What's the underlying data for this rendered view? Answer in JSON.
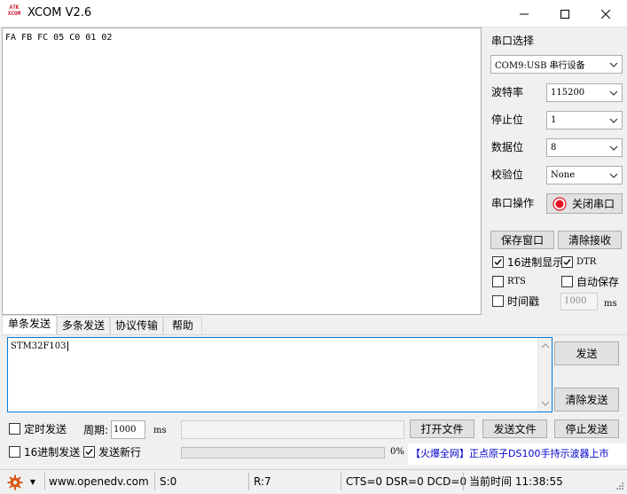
{
  "window": {
    "logo_text": "ATK XCOM",
    "title": "XCOM V2.6"
  },
  "receive": {
    "text": "FA FB FC 05 C0 01 02"
  },
  "serial_panel": {
    "section_title": "串口选择",
    "port_value": "COM9:USB 串行设备",
    "baud_label": "波特率",
    "baud_value": "115200",
    "stop_label": "停止位",
    "stop_value": "1",
    "data_label": "数据位",
    "data_value": "8",
    "parity_label": "校验位",
    "parity_value": "None",
    "op_label": "串口操作",
    "close_port": "关闭串口",
    "save_window": "保存窗口",
    "clear_receive": "清除接收",
    "hex_display": "16进制显示",
    "dtr": "DTR",
    "rts": "RTS",
    "auto_save": "自动保存",
    "timestamp": "时间戳",
    "timestamp_value": "1000",
    "ms": "ms",
    "accent": "#e81123"
  },
  "tabs": [
    "单条发送",
    "多条发送",
    "协议传输",
    "帮助"
  ],
  "send": {
    "text": "STM32F103",
    "send_btn": "发送",
    "clear_send": "清除发送",
    "timed_send": "定时发送",
    "period_label": "周期:",
    "period_value": "1000",
    "ms": "ms",
    "open_file": "打开文件",
    "send_file": "发送文件",
    "stop_send": "停止发送",
    "hex_send": "16进制发送",
    "send_newline": "发送新行",
    "progress_pct": "0%",
    "progress_value": 0,
    "promo_bracket": "【火爆全网】",
    "promo_text": "正点原子DS100手持示波器上市"
  },
  "status": {
    "website": "www.openedv.com",
    "sent": "S:0",
    "received": "R:7",
    "lines": "CTS=0 DSR=0 DCD=0",
    "time": "当前时间 11:38:55"
  }
}
